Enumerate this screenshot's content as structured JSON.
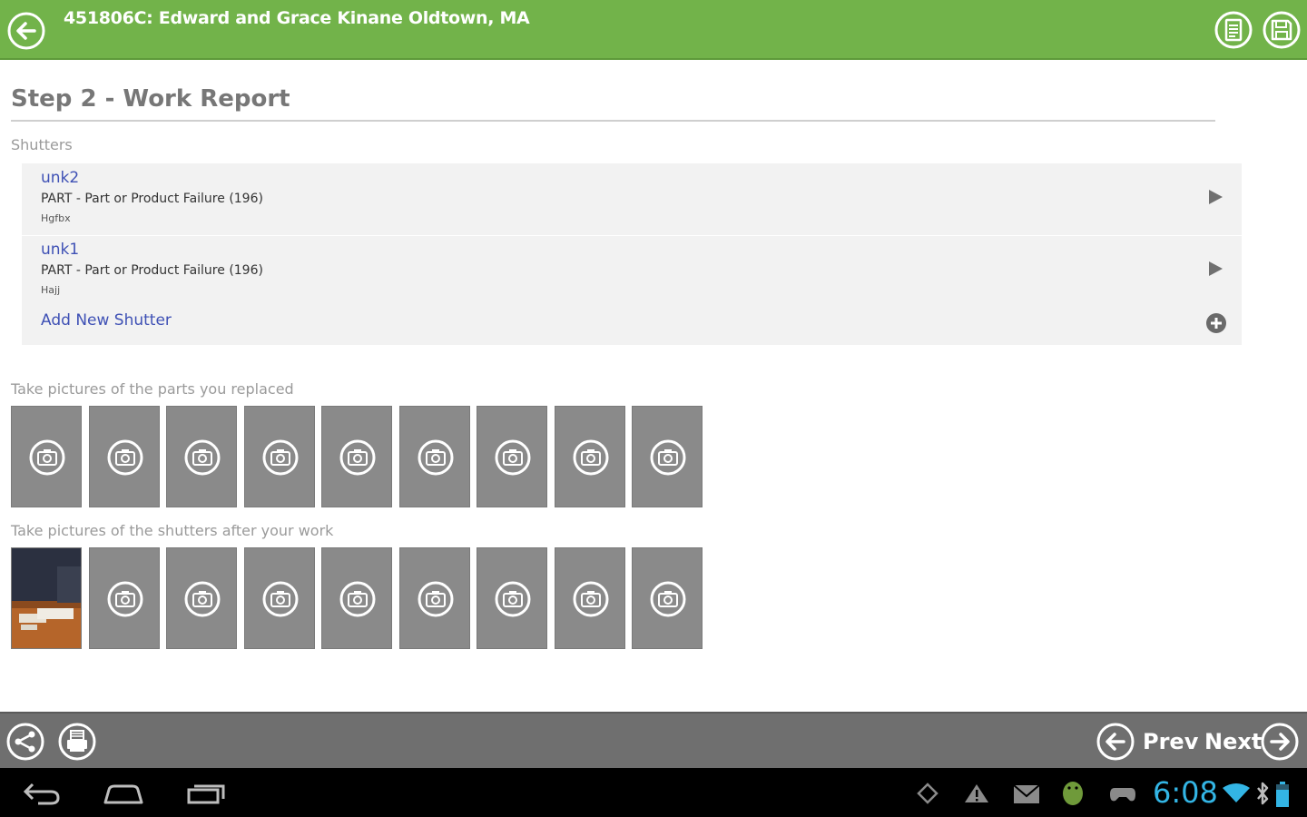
{
  "header": {
    "title": "451806C: Edward  and  Grace Kinane Oldtown, MA"
  },
  "main": {
    "step_title": "Step 2 - Work Report",
    "shutters_label": "Shutters",
    "shutters": [
      {
        "name": "unk2",
        "desc": "PART - Part or Product Failure (196)",
        "note": "Hgfbx"
      },
      {
        "name": "unk1",
        "desc": "PART - Part or Product Failure (196)",
        "note": "Hajj"
      }
    ],
    "add_shutter_label": "Add New Shutter",
    "parts_photos_label": "Take pictures of the parts you replaced",
    "after_photos_label": "Take pictures of the shutters after your work"
  },
  "footer": {
    "prev_label": "Prev",
    "next_label": "Next"
  },
  "system_bar": {
    "time": "6:08"
  },
  "colors": {
    "header_green": "#72b34a",
    "link_blue": "#3f51b5",
    "clock_blue": "#33b5e5"
  }
}
